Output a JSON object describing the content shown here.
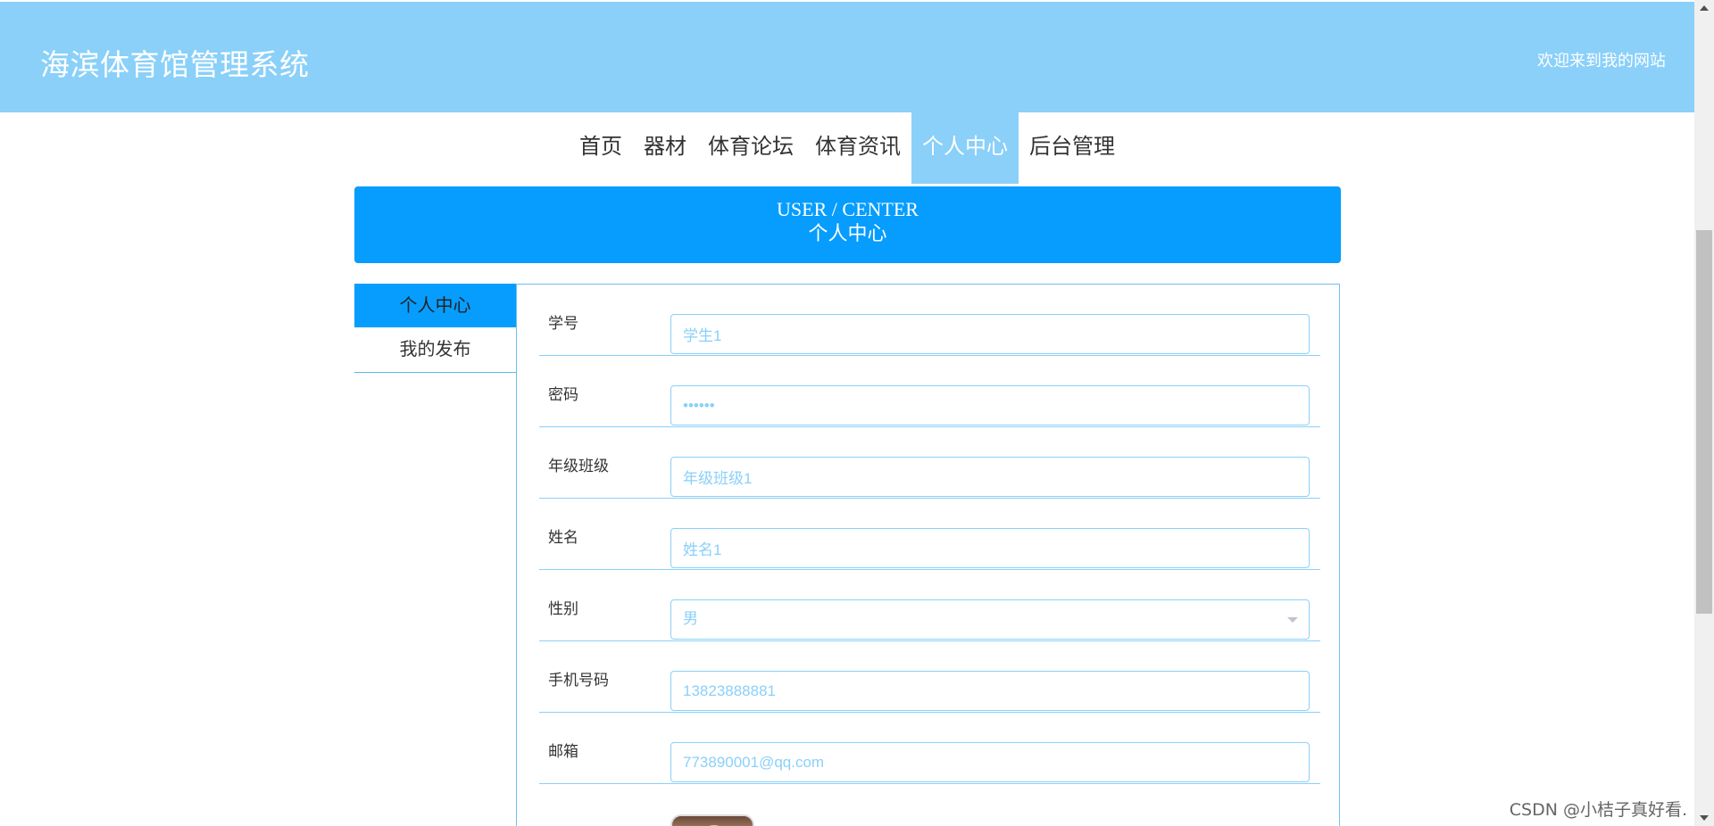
{
  "header": {
    "site_title": "海滨体育馆管理系统",
    "welcome": "欢迎来到我的网站"
  },
  "nav": {
    "items": [
      {
        "label": "首页"
      },
      {
        "label": "器材"
      },
      {
        "label": "体育论坛"
      },
      {
        "label": "体育资讯"
      },
      {
        "label": "个人中心",
        "active": true
      },
      {
        "label": "后台管理"
      }
    ]
  },
  "banner": {
    "en": "USER / CENTER",
    "cn": "个人中心"
  },
  "side_menu": {
    "items": [
      {
        "label": "个人中心",
        "active": true
      },
      {
        "label": "我的发布"
      }
    ]
  },
  "form": {
    "student_id": {
      "label": "学号",
      "value": "学生1"
    },
    "password": {
      "label": "密码",
      "value": "••••••"
    },
    "grade_class": {
      "label": "年级班级",
      "value": "年级班级1"
    },
    "name": {
      "label": "姓名",
      "value": "姓名1"
    },
    "gender": {
      "label": "性别",
      "value": "男"
    },
    "phone": {
      "label": "手机号码",
      "value": "13823888881"
    },
    "email": {
      "label": "邮箱",
      "value": "773890001@qq.com"
    }
  },
  "watermark": "CSDN @小桔子真好看.",
  "colors": {
    "header_bg": "#8ad0f9",
    "banner_bg": "#069dfe",
    "input_text": "#8ad0f9"
  }
}
